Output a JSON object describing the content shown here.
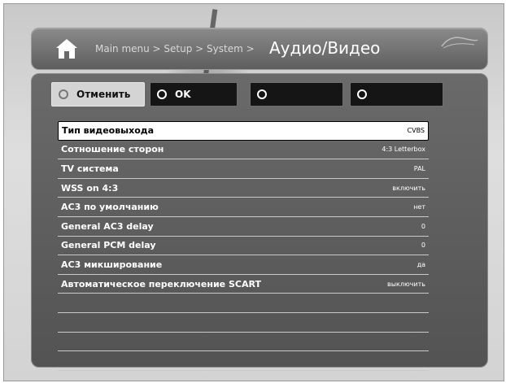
{
  "header": {
    "breadcrumb": "Main menu > Setup > System >",
    "title": "Аудио/Видео",
    "home_icon": "home-icon",
    "logo_icon": "brand-logo"
  },
  "buttons": {
    "cancel": "Отменить",
    "ok": "OK",
    "b3": "",
    "b4": ""
  },
  "settings": [
    {
      "label": "Тип видеовыхода",
      "value": "CVBS",
      "selected": true
    },
    {
      "label": "Сотношение сторон",
      "value": "4:3 Letterbox"
    },
    {
      "label": "TV система",
      "value": "PAL"
    },
    {
      "label": "WSS on 4:3",
      "value": "включить"
    },
    {
      "label": "AC3 по умолчанию",
      "value": "нет"
    },
    {
      "label": "General AC3 delay",
      "value": "0"
    },
    {
      "label": "General PCM delay",
      "value": "0"
    },
    {
      "label": "AC3 микширование",
      "value": "да"
    },
    {
      "label": "Автоматическое переключение SCART",
      "value": "выключить"
    }
  ],
  "colors": {
    "panel": "#5e5e5e",
    "selected_row": "#ffffff",
    "button": "#151515"
  }
}
